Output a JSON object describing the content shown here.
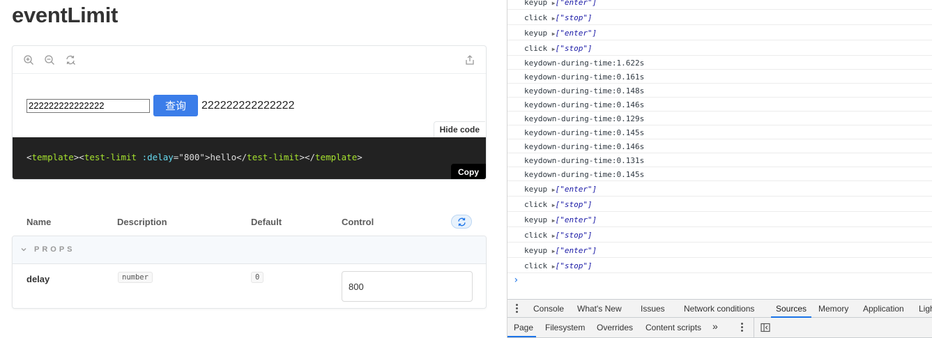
{
  "story": {
    "title": "eventLimit",
    "toolbar": {
      "zoom_in": "zoom-in-icon",
      "zoom_out": "zoom-out-icon",
      "reset_zoom": "reset-zoom-icon",
      "share": "share-icon"
    },
    "demo": {
      "input_value": "222222222222222",
      "button_label": "查询",
      "output_text": "222222222222222"
    },
    "hide_code_label": "Hide code",
    "code": {
      "lt1": "<",
      "tag1": "template",
      "gt1": "><",
      "tag2": "test-limit",
      "sp": " ",
      "attr": ":delay",
      "eq": "=",
      "val": "\"800\"",
      "gt2": ">",
      "content": "hello",
      "close1a": "</",
      "tag3": "test-limit",
      "close1b": "></",
      "tag4": "template",
      "gt3": ">"
    },
    "copy_label": "Copy"
  },
  "args_table": {
    "headers": {
      "name": "Name",
      "description": "Description",
      "default": "Default",
      "control": "Control"
    },
    "section_label": "PROPS",
    "rows": [
      {
        "name": "delay",
        "type": "number",
        "default": "0",
        "control_value": "800"
      }
    ]
  },
  "console": {
    "lines": [
      {
        "kind": "event",
        "name": "keyup",
        "arg": "[\"enter\"]"
      },
      {
        "kind": "event",
        "name": "click",
        "arg": "[\"stop\"]"
      },
      {
        "kind": "event",
        "name": "keyup",
        "arg": "[\"enter\"]"
      },
      {
        "kind": "event",
        "name": "click",
        "arg": "[\"stop\"]"
      },
      {
        "kind": "text",
        "text": "keydown-during-time:1.622s"
      },
      {
        "kind": "text",
        "text": "keydown-during-time:0.161s"
      },
      {
        "kind": "text",
        "text": "keydown-during-time:0.148s"
      },
      {
        "kind": "text",
        "text": "keydown-during-time:0.146s"
      },
      {
        "kind": "text",
        "text": "keydown-during-time:0.129s"
      },
      {
        "kind": "text",
        "text": "keydown-during-time:0.145s"
      },
      {
        "kind": "text",
        "text": "keydown-during-time:0.146s"
      },
      {
        "kind": "text",
        "text": "keydown-during-time:0.131s"
      },
      {
        "kind": "text",
        "text": "keydown-during-time:0.145s"
      },
      {
        "kind": "event",
        "name": "keyup",
        "arg": "[\"enter\"]"
      },
      {
        "kind": "event",
        "name": "click",
        "arg": "[\"stop\"]"
      },
      {
        "kind": "event",
        "name": "keyup",
        "arg": "[\"enter\"]"
      },
      {
        "kind": "event",
        "name": "click",
        "arg": "[\"stop\"]"
      },
      {
        "kind": "event",
        "name": "keyup",
        "arg": "[\"enter\"]"
      },
      {
        "kind": "event",
        "name": "click",
        "arg": "[\"stop\"]"
      }
    ],
    "prompt_symbol": "›"
  },
  "devtools": {
    "drawer_tabs": [
      "Console",
      "What's New",
      "Issues",
      "Network conditions",
      "Sources",
      "Memory",
      "Application",
      "Ligh"
    ],
    "active_drawer_tab": "Sources",
    "sub_tabs": [
      "Page",
      "Filesystem",
      "Overrides",
      "Content scripts"
    ],
    "active_sub_tab": "Page",
    "more_tabs_symbol": "»",
    "accent_color": "#1a73e8"
  }
}
